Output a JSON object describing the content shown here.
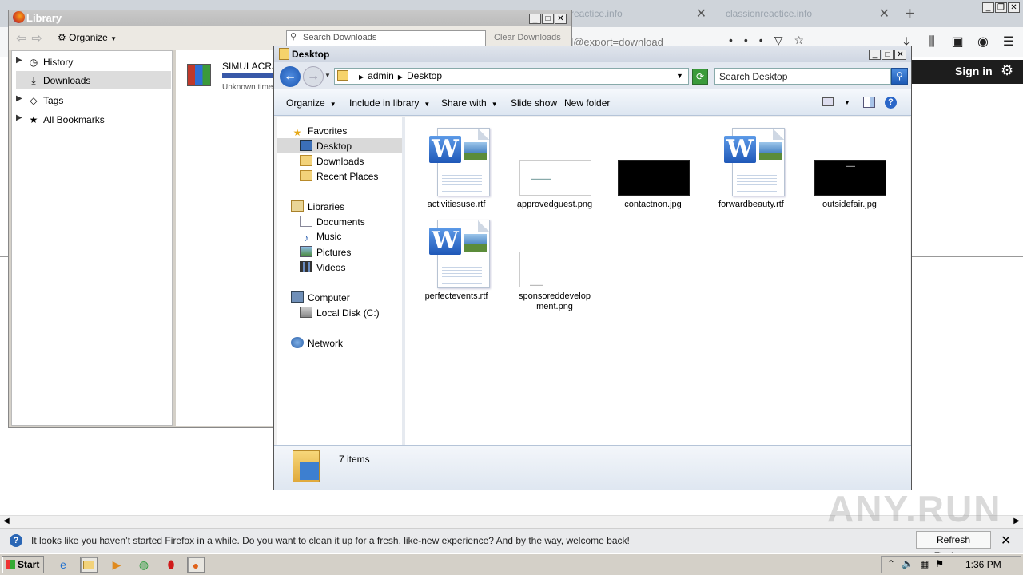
{
  "firefox": {
    "tabs": [
      {
        "title": "reactice.info"
      },
      {
        "title": "classionreactice.info"
      }
    ],
    "tab_close_glyph": "✕",
    "new_tab_glyph": "+",
    "url_text": "d@export=download",
    "site_signin": "Sign in"
  },
  "library": {
    "title": "Library",
    "organize": "Organize",
    "search_placeholder": "Search Downloads",
    "clear_downloads": "Clear Downloads",
    "sidebar": [
      {
        "label": "History",
        "icon": "clock-icon"
      },
      {
        "label": "Downloads",
        "icon": "download-icon"
      },
      {
        "label": "Tags",
        "icon": "tag-icon"
      },
      {
        "label": "All Bookmarks",
        "icon": "star-icon"
      }
    ],
    "download": {
      "name": "SIMULACRA.r",
      "status": "Unknown time"
    }
  },
  "explorer": {
    "title": "Desktop",
    "breadcrumb": [
      "admin",
      "Desktop"
    ],
    "search_placeholder": "Search Desktop",
    "commands": [
      "Organize",
      "Include in library",
      "Share with",
      "Slide show",
      "New folder"
    ],
    "nav": {
      "favorites": "Favorites",
      "favorites_items": [
        "Desktop",
        "Downloads",
        "Recent Places"
      ],
      "libraries": "Libraries",
      "libraries_items": [
        "Documents",
        "Music",
        "Pictures",
        "Videos"
      ],
      "computer": "Computer",
      "computer_items": [
        "Local Disk (C:)"
      ],
      "network": "Network"
    },
    "files": [
      {
        "name": "activitiesuse.rtf",
        "type": "word"
      },
      {
        "name": "approvedguest.png",
        "type": "image-light"
      },
      {
        "name": "contactnon.jpg",
        "type": "image-dark"
      },
      {
        "name": "forwardbeauty.rtf",
        "type": "word"
      },
      {
        "name": "outsidefair.jpg",
        "type": "image-dark"
      },
      {
        "name": "perfectevents.rtf",
        "type": "word"
      },
      {
        "name": "sponsoreddevelopment.png",
        "type": "image-light"
      }
    ],
    "status": "7 items"
  },
  "notification": {
    "text": "It looks like you haven’t started Firefox in a while. Do you want to clean it up for a fresh, like-new experience? And by the way, welcome back!",
    "button": "Refresh Firefox…"
  },
  "taskbar": {
    "start": "Start",
    "clock": "1:36 PM"
  },
  "watermark": "ANY.RUN"
}
